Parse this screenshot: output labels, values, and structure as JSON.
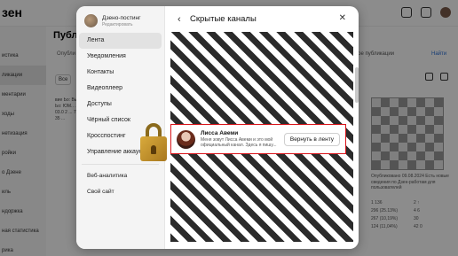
{
  "background": {
    "logo": "зен",
    "title": "Публи",
    "sidebar": [
      "",
      "истика",
      "ликации",
      "ментарии",
      "ходы",
      "нетизация",
      "ройки",
      "",
      "о Дзене",
      "иль",
      "ндоржка",
      "",
      "ная статистика",
      "рика"
    ],
    "tab": "Опубли",
    "filter": "Все",
    "card_text": "вие Ьо: Вы Ьо: ЮМ.. ... 03.0 2 ... 77 35 ...",
    "right_tab": "вое публикации",
    "right_tab_link": "Найти",
    "right_caption": "Опубликовано 09.08.2024 Есть новые сведения по Дзен-работам для пользователей",
    "right_stats": [
      "1 136",
      "2 ↑",
      "296 (25.13%)",
      "4 6",
      "267 (10,19%)",
      "30",
      "124 (11,04%)",
      "42 0"
    ]
  },
  "modal": {
    "profile": {
      "name": "Дзено-постинг",
      "subtitle": "Редактировать"
    },
    "menu": {
      "items": [
        "Лента",
        "Уведомления",
        "Контакты",
        "Видеоплеер",
        "Доступы",
        "Чёрный список",
        "Кросспостинг",
        "Управление аккаунтом"
      ],
      "extra": [
        "Веб-аналитика",
        "Свой сайт"
      ]
    },
    "header": {
      "title": "Скрытые каналы"
    },
    "channel": {
      "name": "Лисса Авеми",
      "description": "Меня зовут Лисса Авеми и это мой официальный канал. Здесь я пишу...",
      "button": "Вернуть в ленту"
    }
  },
  "colors": {
    "highlight": "#d9151b",
    "modal_bg": "#ffffff",
    "menu_bg": "#f4f4f4"
  },
  "icons": {
    "back": "chevron-left-icon",
    "close": "close-icon",
    "lock": "lock-icon"
  }
}
